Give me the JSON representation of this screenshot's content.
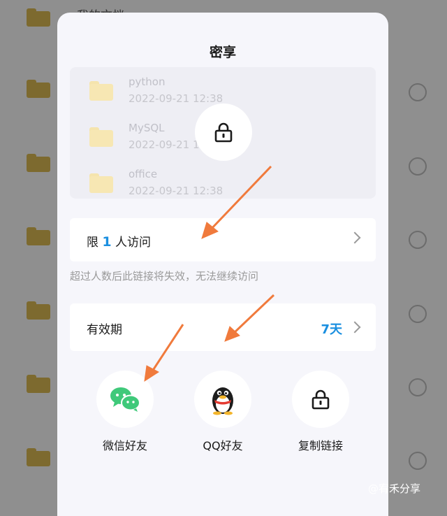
{
  "background": {
    "title": "我的文档",
    "rows": 7
  },
  "dialog": {
    "title": "密享",
    "preview_items": [
      {
        "name": "python",
        "date": "2022-09-21  12:38"
      },
      {
        "name": "MySQL",
        "date": "2022-09-21  12:38"
      },
      {
        "name": "office",
        "date": "2022-09-21  12:38"
      }
    ],
    "limit": {
      "prefix": "限",
      "count": "1",
      "suffix": "人访问"
    },
    "limit_hint": "超过人数后此链接将失效，无法继续访问",
    "validity": {
      "label": "有效期",
      "value": "7天"
    },
    "share_options": [
      {
        "label": "微信好友",
        "icon": "wechat-icon"
      },
      {
        "label": "QQ好友",
        "icon": "qq-penguin-icon"
      },
      {
        "label": "复制链接",
        "icon": "lock-icon"
      }
    ]
  },
  "watermark": "@宥禾分享",
  "colors": {
    "accent": "#1a8fe0",
    "wechat": "#3fc97a",
    "arrow": "#f07a3c",
    "folder_bg": "#7d6a2f"
  }
}
